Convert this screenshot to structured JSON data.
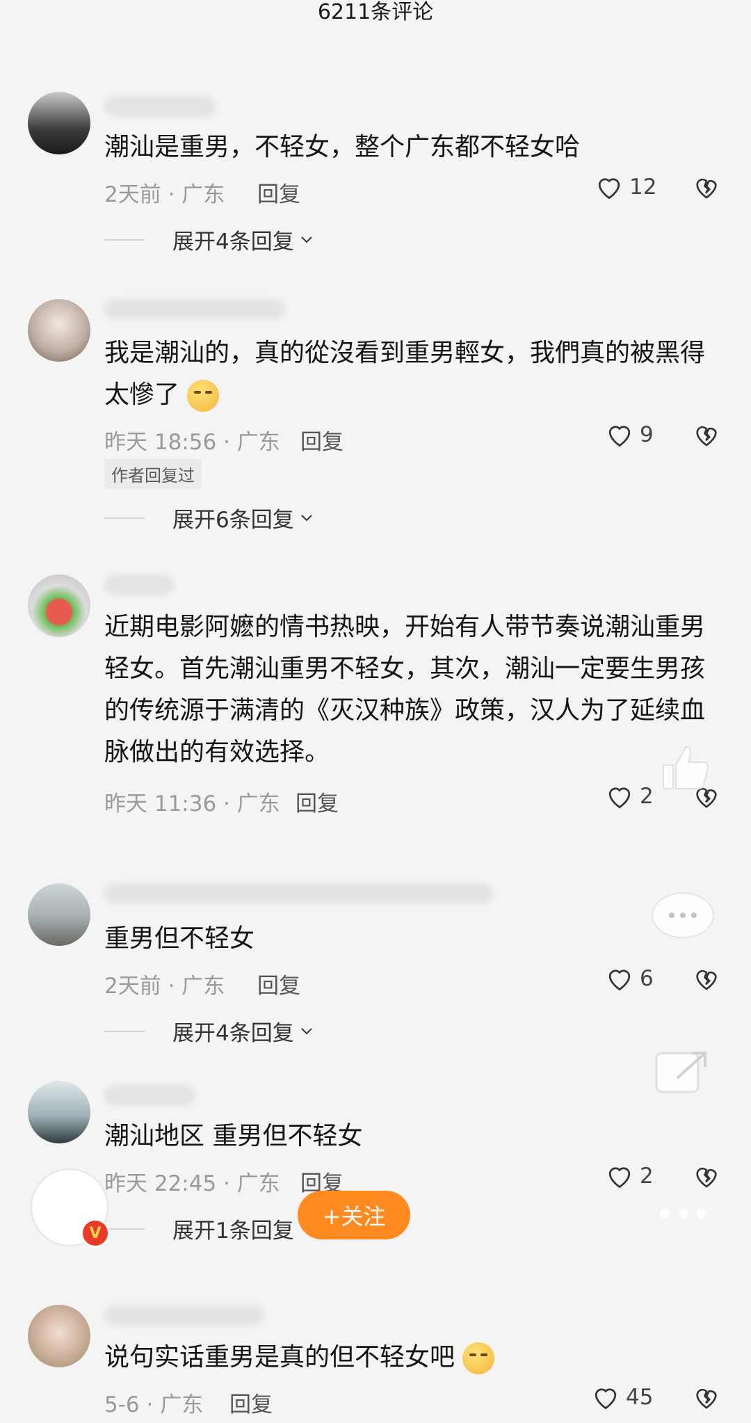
{
  "header": {
    "title": "6211条评论"
  },
  "actions": {
    "reply": "回复",
    "follow": "+关注"
  },
  "comments": [
    {
      "text": "潮汕是重男，不轻女，整个广东都不轻女哈",
      "time": "2天前 · 广东",
      "likes": "12",
      "expand": "展开4条回复"
    },
    {
      "text": "我是潮汕的，真的從沒看到重男輕女，我們真的被黑得太慘了",
      "emoji": "crying-face",
      "time": "昨天 18:56 · 广东",
      "likes": "9",
      "author_tag": "作者回复过",
      "expand": "展开6条回复"
    },
    {
      "text": "近期电影阿嬷的情书热映，开始有人带节奏说潮汕重男轻女。首先潮汕重男不轻女，其次，潮汕一定要生男孩的传统源于满清的《灭汉种族》政策，汉人为了延续血脉做出的有效选择。",
      "time": "昨天 11:36 · 广东",
      "likes": "2"
    },
    {
      "text": "重男但不轻女",
      "time": "2天前 · 广东",
      "likes": "6",
      "expand": "展开4条回复"
    },
    {
      "text": "潮汕地区 重男但不轻女",
      "time": "昨天 22:45 · 广东",
      "likes": "2",
      "expand": "展开1条回复"
    },
    {
      "text": "说句实话重男是真的但不轻女吧",
      "emoji": "persevering-face",
      "time": "5-6 · 广东",
      "likes": "45"
    }
  ],
  "colors": {
    "follow": "#ff8a1f",
    "meta": "#9a9a9a",
    "background": "#f4f4f4"
  }
}
